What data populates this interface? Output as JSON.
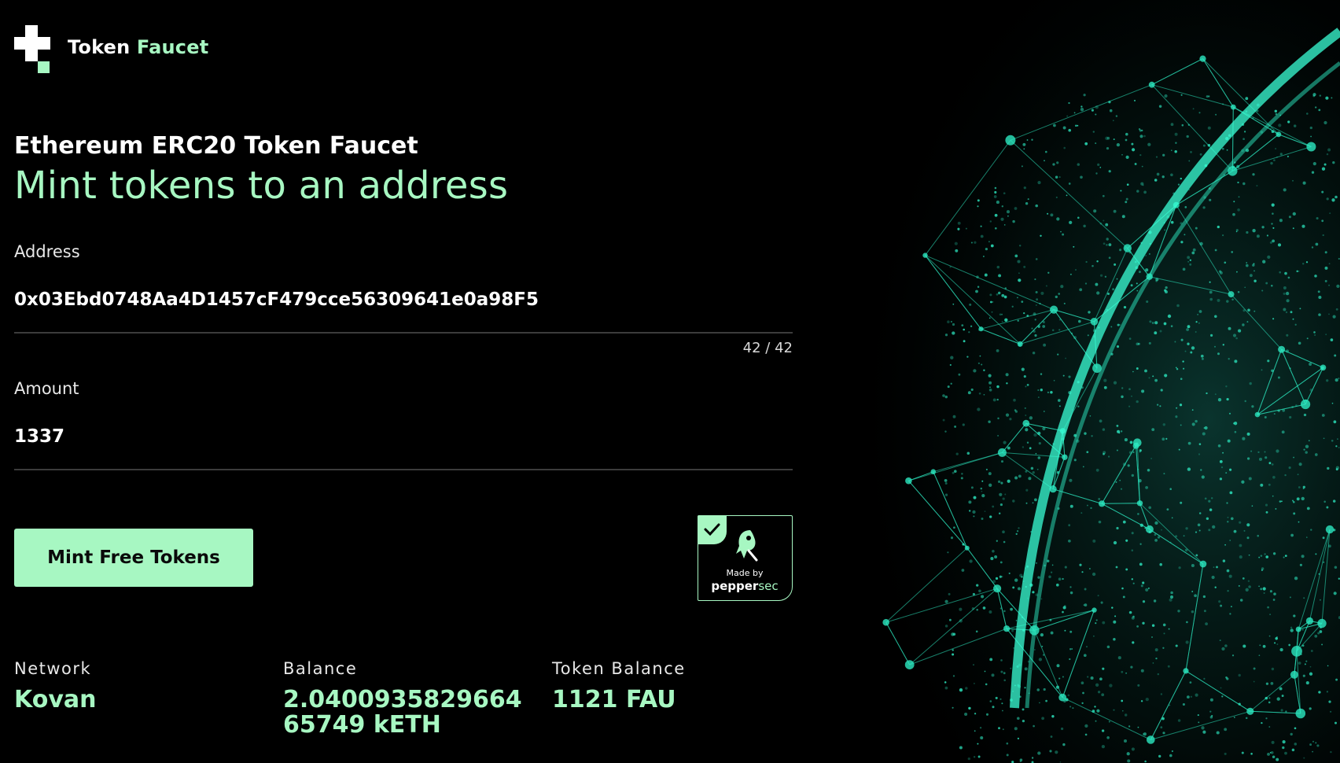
{
  "app": {
    "brand_word1": "Token",
    "brand_word2": "Faucet"
  },
  "hero": {
    "kicker": "Ethereum ERC20 Token Faucet",
    "headline": "Mint tokens to an address"
  },
  "form": {
    "address_label": "Address",
    "address_value": "0x03Ebd0748Aa4D1457cF479cce56309641e0a98F5",
    "address_counter": "42 / 42",
    "amount_label": "Amount",
    "amount_value": "1337",
    "submit_label": "Mint Free Tokens"
  },
  "badge": {
    "made_by": "Made by",
    "brand_bold": "pepper",
    "brand_light": "sec",
    "icons": [
      "check-icon",
      "knight-mascot-icon"
    ]
  },
  "stats": {
    "network_label": "Network",
    "network_value": "Kovan",
    "balance_label": "Balance",
    "balance_value": "2.040093582966465749 kETH",
    "token_balance_label": "Token Balance",
    "token_balance_value": "1121 FAU"
  },
  "colors": {
    "background": "#000000",
    "accent": "#a7f7c2",
    "globe": "#2ce8c0"
  }
}
